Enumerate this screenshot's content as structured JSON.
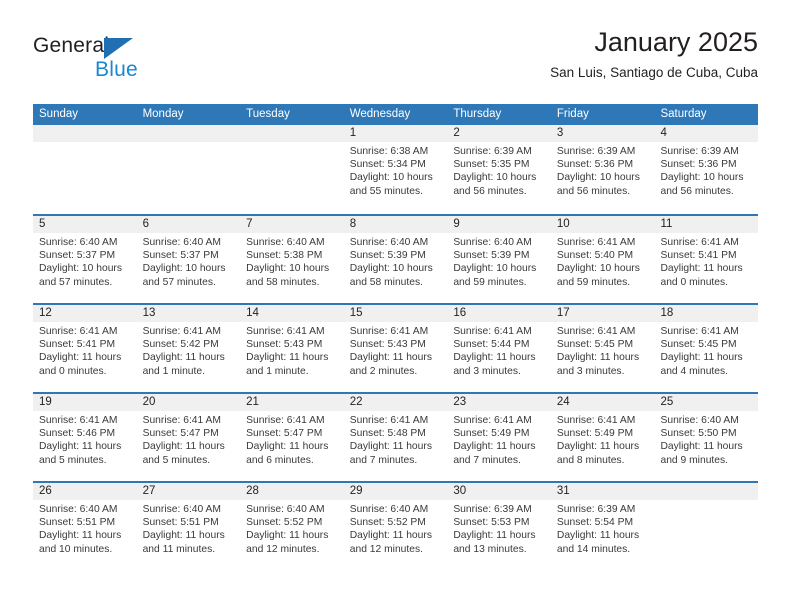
{
  "brand": {
    "name_part1": "General",
    "name_part2": "Blue",
    "triangle_color": "#1f6fb2",
    "blue_color": "#1b87d2"
  },
  "header": {
    "title": "January 2025",
    "subtitle": "San Luis, Santiago de Cuba, Cuba",
    "accent_color": "#2e78b8"
  },
  "calendar": {
    "weekdays": [
      "Sunday",
      "Monday",
      "Tuesday",
      "Wednesday",
      "Thursday",
      "Friday",
      "Saturday"
    ],
    "weeks": [
      [
        {
          "day": "",
          "sunrise": "",
          "sunset": "",
          "daylight_line1": "",
          "daylight_line2": ""
        },
        {
          "day": "",
          "sunrise": "",
          "sunset": "",
          "daylight_line1": "",
          "daylight_line2": ""
        },
        {
          "day": "",
          "sunrise": "",
          "sunset": "",
          "daylight_line1": "",
          "daylight_line2": ""
        },
        {
          "day": "1",
          "sunrise": "Sunrise: 6:38 AM",
          "sunset": "Sunset: 5:34 PM",
          "daylight_line1": "Daylight: 10 hours",
          "daylight_line2": "and 55 minutes."
        },
        {
          "day": "2",
          "sunrise": "Sunrise: 6:39 AM",
          "sunset": "Sunset: 5:35 PM",
          "daylight_line1": "Daylight: 10 hours",
          "daylight_line2": "and 56 minutes."
        },
        {
          "day": "3",
          "sunrise": "Sunrise: 6:39 AM",
          "sunset": "Sunset: 5:36 PM",
          "daylight_line1": "Daylight: 10 hours",
          "daylight_line2": "and 56 minutes."
        },
        {
          "day": "4",
          "sunrise": "Sunrise: 6:39 AM",
          "sunset": "Sunset: 5:36 PM",
          "daylight_line1": "Daylight: 10 hours",
          "daylight_line2": "and 56 minutes."
        }
      ],
      [
        {
          "day": "5",
          "sunrise": "Sunrise: 6:40 AM",
          "sunset": "Sunset: 5:37 PM",
          "daylight_line1": "Daylight: 10 hours",
          "daylight_line2": "and 57 minutes."
        },
        {
          "day": "6",
          "sunrise": "Sunrise: 6:40 AM",
          "sunset": "Sunset: 5:37 PM",
          "daylight_line1": "Daylight: 10 hours",
          "daylight_line2": "and 57 minutes."
        },
        {
          "day": "7",
          "sunrise": "Sunrise: 6:40 AM",
          "sunset": "Sunset: 5:38 PM",
          "daylight_line1": "Daylight: 10 hours",
          "daylight_line2": "and 58 minutes."
        },
        {
          "day": "8",
          "sunrise": "Sunrise: 6:40 AM",
          "sunset": "Sunset: 5:39 PM",
          "daylight_line1": "Daylight: 10 hours",
          "daylight_line2": "and 58 minutes."
        },
        {
          "day": "9",
          "sunrise": "Sunrise: 6:40 AM",
          "sunset": "Sunset: 5:39 PM",
          "daylight_line1": "Daylight: 10 hours",
          "daylight_line2": "and 59 minutes."
        },
        {
          "day": "10",
          "sunrise": "Sunrise: 6:41 AM",
          "sunset": "Sunset: 5:40 PM",
          "daylight_line1": "Daylight: 10 hours",
          "daylight_line2": "and 59 minutes."
        },
        {
          "day": "11",
          "sunrise": "Sunrise: 6:41 AM",
          "sunset": "Sunset: 5:41 PM",
          "daylight_line1": "Daylight: 11 hours",
          "daylight_line2": "and 0 minutes."
        }
      ],
      [
        {
          "day": "12",
          "sunrise": "Sunrise: 6:41 AM",
          "sunset": "Sunset: 5:41 PM",
          "daylight_line1": "Daylight: 11 hours",
          "daylight_line2": "and 0 minutes."
        },
        {
          "day": "13",
          "sunrise": "Sunrise: 6:41 AM",
          "sunset": "Sunset: 5:42 PM",
          "daylight_line1": "Daylight: 11 hours",
          "daylight_line2": "and 1 minute."
        },
        {
          "day": "14",
          "sunrise": "Sunrise: 6:41 AM",
          "sunset": "Sunset: 5:43 PM",
          "daylight_line1": "Daylight: 11 hours",
          "daylight_line2": "and 1 minute."
        },
        {
          "day": "15",
          "sunrise": "Sunrise: 6:41 AM",
          "sunset": "Sunset: 5:43 PM",
          "daylight_line1": "Daylight: 11 hours",
          "daylight_line2": "and 2 minutes."
        },
        {
          "day": "16",
          "sunrise": "Sunrise: 6:41 AM",
          "sunset": "Sunset: 5:44 PM",
          "daylight_line1": "Daylight: 11 hours",
          "daylight_line2": "and 3 minutes."
        },
        {
          "day": "17",
          "sunrise": "Sunrise: 6:41 AM",
          "sunset": "Sunset: 5:45 PM",
          "daylight_line1": "Daylight: 11 hours",
          "daylight_line2": "and 3 minutes."
        },
        {
          "day": "18",
          "sunrise": "Sunrise: 6:41 AM",
          "sunset": "Sunset: 5:45 PM",
          "daylight_line1": "Daylight: 11 hours",
          "daylight_line2": "and 4 minutes."
        }
      ],
      [
        {
          "day": "19",
          "sunrise": "Sunrise: 6:41 AM",
          "sunset": "Sunset: 5:46 PM",
          "daylight_line1": "Daylight: 11 hours",
          "daylight_line2": "and 5 minutes."
        },
        {
          "day": "20",
          "sunrise": "Sunrise: 6:41 AM",
          "sunset": "Sunset: 5:47 PM",
          "daylight_line1": "Daylight: 11 hours",
          "daylight_line2": "and 5 minutes."
        },
        {
          "day": "21",
          "sunrise": "Sunrise: 6:41 AM",
          "sunset": "Sunset: 5:47 PM",
          "daylight_line1": "Daylight: 11 hours",
          "daylight_line2": "and 6 minutes."
        },
        {
          "day": "22",
          "sunrise": "Sunrise: 6:41 AM",
          "sunset": "Sunset: 5:48 PM",
          "daylight_line1": "Daylight: 11 hours",
          "daylight_line2": "and 7 minutes."
        },
        {
          "day": "23",
          "sunrise": "Sunrise: 6:41 AM",
          "sunset": "Sunset: 5:49 PM",
          "daylight_line1": "Daylight: 11 hours",
          "daylight_line2": "and 7 minutes."
        },
        {
          "day": "24",
          "sunrise": "Sunrise: 6:41 AM",
          "sunset": "Sunset: 5:49 PM",
          "daylight_line1": "Daylight: 11 hours",
          "daylight_line2": "and 8 minutes."
        },
        {
          "day": "25",
          "sunrise": "Sunrise: 6:40 AM",
          "sunset": "Sunset: 5:50 PM",
          "daylight_line1": "Daylight: 11 hours",
          "daylight_line2": "and 9 minutes."
        }
      ],
      [
        {
          "day": "26",
          "sunrise": "Sunrise: 6:40 AM",
          "sunset": "Sunset: 5:51 PM",
          "daylight_line1": "Daylight: 11 hours",
          "daylight_line2": "and 10 minutes."
        },
        {
          "day": "27",
          "sunrise": "Sunrise: 6:40 AM",
          "sunset": "Sunset: 5:51 PM",
          "daylight_line1": "Daylight: 11 hours",
          "daylight_line2": "and 11 minutes."
        },
        {
          "day": "28",
          "sunrise": "Sunrise: 6:40 AM",
          "sunset": "Sunset: 5:52 PM",
          "daylight_line1": "Daylight: 11 hours",
          "daylight_line2": "and 12 minutes."
        },
        {
          "day": "29",
          "sunrise": "Sunrise: 6:40 AM",
          "sunset": "Sunset: 5:52 PM",
          "daylight_line1": "Daylight: 11 hours",
          "daylight_line2": "and 12 minutes."
        },
        {
          "day": "30",
          "sunrise": "Sunrise: 6:39 AM",
          "sunset": "Sunset: 5:53 PM",
          "daylight_line1": "Daylight: 11 hours",
          "daylight_line2": "and 13 minutes."
        },
        {
          "day": "31",
          "sunrise": "Sunrise: 6:39 AM",
          "sunset": "Sunset: 5:54 PM",
          "daylight_line1": "Daylight: 11 hours",
          "daylight_line2": "and 14 minutes."
        },
        {
          "day": "",
          "sunrise": "",
          "sunset": "",
          "daylight_line1": "",
          "daylight_line2": ""
        }
      ]
    ]
  }
}
